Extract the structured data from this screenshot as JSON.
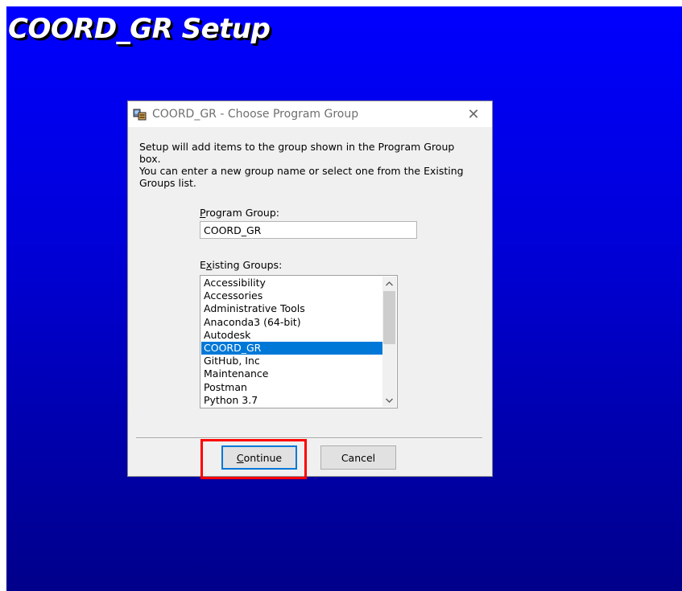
{
  "setup": {
    "title": "COORD_GR Setup"
  },
  "dialog": {
    "title": "COORD_GR - Choose Program Group",
    "close_glyph": "✕",
    "description": "Setup will add items to the group shown in the Program Group box.\nYou can enter a new group name or select one from the Existing\nGroups list.",
    "program_group": {
      "label_underlined": "P",
      "label_rest": "rogram Group:",
      "value": "COORD_GR"
    },
    "existing_groups": {
      "label_before": "E",
      "label_underlined": "x",
      "label_rest": "isting Groups:",
      "items": [
        "Accessibility",
        "Accessories",
        "Administrative Tools",
        "Anaconda3 (64-bit)",
        "Autodesk",
        "COORD_GR",
        "GitHub, Inc",
        "Maintenance",
        "Postman",
        "Python 3.7"
      ],
      "selected": "COORD_GR"
    },
    "buttons": {
      "continue_underlined": "C",
      "continue_rest": "ontinue",
      "cancel": "Cancel"
    }
  },
  "colors": {
    "background_top": "#0000ff",
    "background_bottom": "#00008a",
    "selection": "#0078d7",
    "highlight": "#ff0000"
  },
  "icons": {
    "app": "setup-icon",
    "close": "close-icon",
    "scroll_up": "chevron-up-icon",
    "scroll_down": "chevron-down-icon"
  }
}
